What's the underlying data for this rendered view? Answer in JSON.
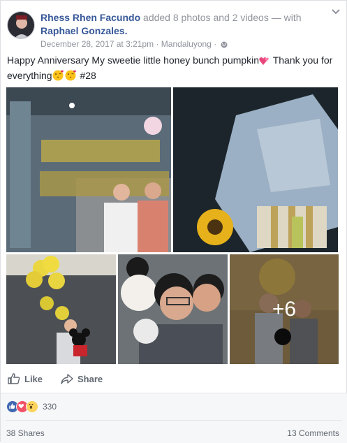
{
  "post": {
    "author": "Rhess Rhen Facundo",
    "action_text": "added 8 photos and 2 videos — with",
    "tagged": "Raphael Gonzales.",
    "date": "December 28, 2017 at 3:21pm",
    "separator": "·",
    "location": "Mandaluyong",
    "visibility_icon": "globe-icon",
    "text_part1": "Happy Anniversary My sweetie little honey bunch pumpkin",
    "text_part2": " Thank you for everything",
    "text_part3": " #28",
    "more_photos": "+6"
  },
  "actions": {
    "like": "Like",
    "share": "Share"
  },
  "reactions": {
    "icons": [
      "like-reaction-icon",
      "love-reaction-icon",
      "wow-reaction-icon"
    ],
    "count": "330"
  },
  "footer": {
    "shares": "38 Shares",
    "comments": "13 Comments"
  },
  "colors": {
    "link": "#365899",
    "muted": "#90949c",
    "like_blue": "#4267b2",
    "love_red": "#f25268",
    "wow_yellow": "#fcd35d"
  }
}
